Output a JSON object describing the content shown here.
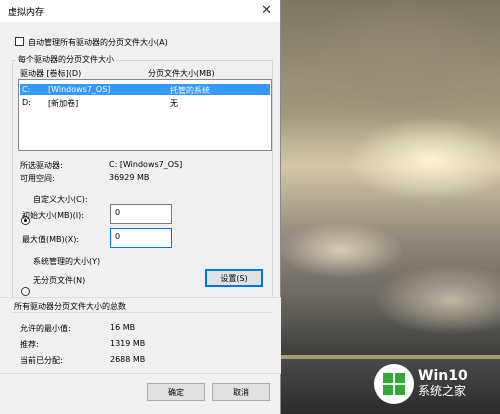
{
  "dialog": {
    "title": "虚拟内存",
    "close_glyph": "✕",
    "auto_manage_label": "自动管理所有驱动器的分页文件大小(A)",
    "per_drive_group_title": "每个驱动器的分页文件大小",
    "columns": {
      "drive": "驱动器 [卷标](D)",
      "pagefile_size": "分页文件大小(MB)"
    },
    "drives": [
      {
        "letter": "C:",
        "label": "[Windows7_OS]",
        "size": "托管的系统",
        "selected": true
      },
      {
        "letter": "D:",
        "label": "[新加卷]",
        "size": "无",
        "selected": false
      }
    ],
    "selected_drive_label": "所选驱动器:",
    "selected_drive_value": "C:  [Windows7_OS]",
    "free_space_label": "可用空间:",
    "free_space_value": "36929 MB",
    "custom_size_label": "自定义大小(C):",
    "initial_size_label": "初始大小(MB)(I):",
    "initial_size_value": "0",
    "max_size_label": "最大值(MB)(X):",
    "max_size_value": "0",
    "system_managed_label": "系统管理的大小(Y)",
    "no_pagefile_label": "无分页文件(N)",
    "set_button": "设置(S)",
    "totals_group_title": "所有驱动器分页文件大小的总数",
    "min_allowed_label": "允许的最小值:",
    "min_allowed_value": "16 MB",
    "recommended_label": "推荐:",
    "recommended_value": "1319 MB",
    "current_allocated_label": "当前已分配:",
    "current_allocated_value": "2688 MB",
    "ok_button": "确定",
    "cancel_button": "取消"
  },
  "watermark": {
    "line1": "Win10",
    "line2": "系统之家",
    "logo_color": "#33aa33"
  },
  "colors": {
    "selection": "#3399ff",
    "focus_border": "#0078d7",
    "dialog_bg": "#f0f0f0"
  }
}
